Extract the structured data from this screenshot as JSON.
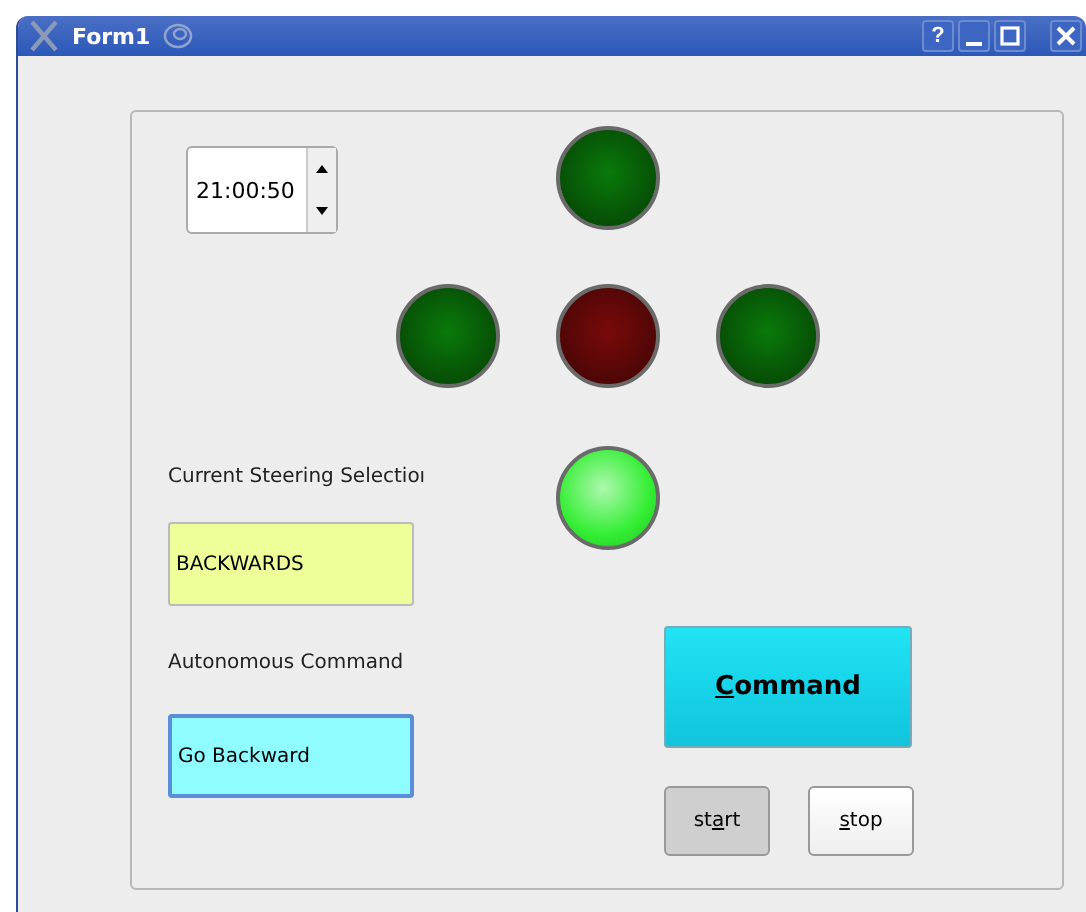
{
  "window": {
    "title": "Form1",
    "buttons": [
      {
        "kind": "help",
        "label": "?"
      },
      {
        "kind": "minimize"
      },
      {
        "kind": "maximize"
      },
      {
        "kind": "close"
      }
    ]
  },
  "time_spinner": {
    "value": "21:00:50"
  },
  "lights": [
    {
      "on": false,
      "color": "#0a7a0a"
    },
    {
      "on": false,
      "color": "#0a7a0a"
    },
    {
      "on": false,
      "color": "#7a0a0a"
    },
    {
      "on": false,
      "color": "#0a7a0a"
    },
    {
      "on": true,
      "color": "#33ee33"
    }
  ],
  "steering": {
    "label": "Current Steering Selectioı",
    "value": "BACKWARDS"
  },
  "autonomous": {
    "label": "Autonomous Command",
    "value": "Go Backward"
  },
  "buttons": [
    {
      "kind": "command",
      "label_parts": [
        {
          "text": "C",
          "underlined": true
        },
        {
          "text": "ommand",
          "underlined": false
        }
      ],
      "pressed": false
    },
    {
      "kind": "small",
      "label_parts": [
        {
          "text": "st",
          "underlined": false
        },
        {
          "text": "a",
          "underlined": true
        },
        {
          "text": "rt",
          "underlined": false
        }
      ],
      "pressed": true
    },
    {
      "kind": "small",
      "label_parts": [
        {
          "text": "s",
          "underlined": true
        },
        {
          "text": "top",
          "underlined": false
        }
      ],
      "pressed": false
    }
  ]
}
